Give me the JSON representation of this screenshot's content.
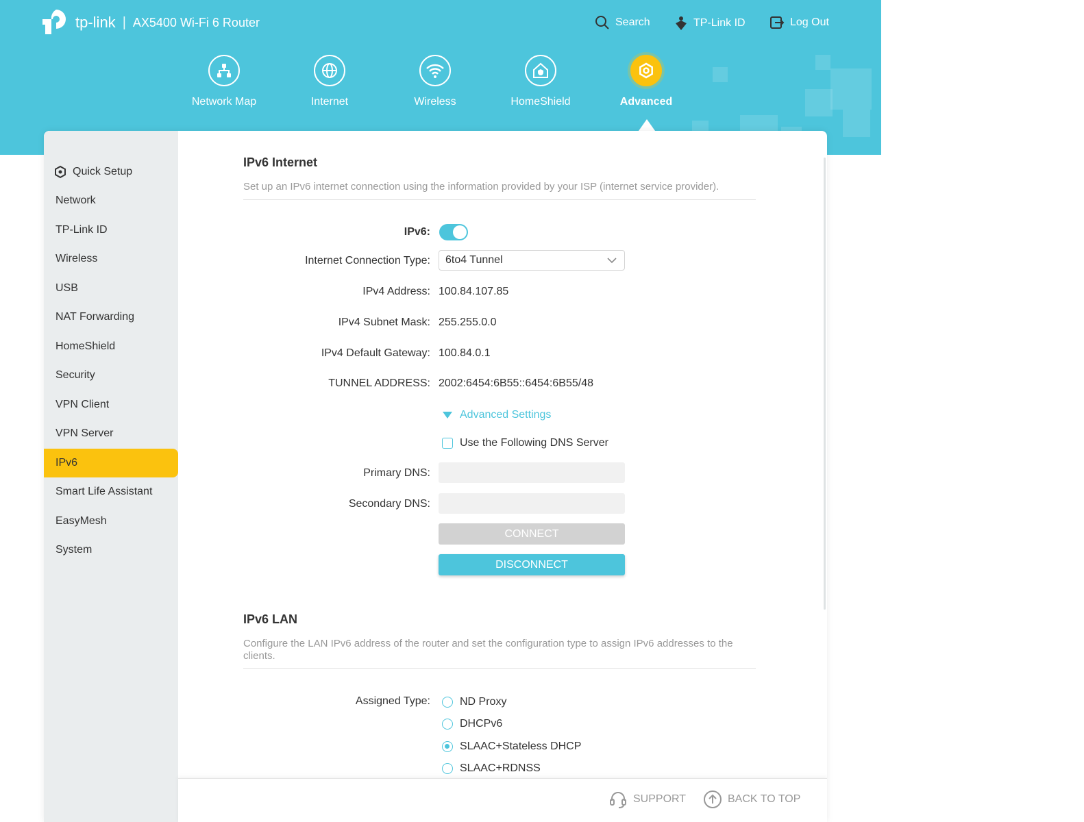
{
  "header": {
    "brand": "tp-link",
    "separator": "|",
    "model": "AX5400 Wi-Fi 6 Router",
    "search_label": "Search",
    "tplink_id_label": "TP-Link ID",
    "logout_label": "Log Out"
  },
  "nav": [
    {
      "label": "Network Map",
      "icon": "network-map-icon"
    },
    {
      "label": "Internet",
      "icon": "globe-icon"
    },
    {
      "label": "Wireless",
      "icon": "wifi-icon"
    },
    {
      "label": "HomeShield",
      "icon": "homeshield-icon"
    },
    {
      "label": "Advanced",
      "icon": "gear-icon",
      "active": true
    }
  ],
  "sidebar": {
    "items": [
      {
        "label": "Quick Setup",
        "icon": "quick-setup-gear-icon"
      },
      {
        "label": "Network"
      },
      {
        "label": "TP-Link ID"
      },
      {
        "label": "Wireless"
      },
      {
        "label": "USB"
      },
      {
        "label": "NAT Forwarding"
      },
      {
        "label": "HomeShield"
      },
      {
        "label": "Security"
      },
      {
        "label": "VPN Client"
      },
      {
        "label": "VPN Server"
      },
      {
        "label": "IPv6",
        "active": true
      },
      {
        "label": "Smart Life Assistant"
      },
      {
        "label": "EasyMesh"
      },
      {
        "label": "System"
      }
    ]
  },
  "ipv6_internet": {
    "title": "IPv6 Internet",
    "description": "Set up an IPv6 internet connection using the information provided by your ISP (internet service provider).",
    "ipv6_label": "IPv6:",
    "ipv6_enabled": true,
    "connection_type_label": "Internet Connection Type:",
    "connection_type_value": "6to4 Tunnel",
    "ipv4_address_label": "IPv4 Address:",
    "ipv4_address_value": "100.84.107.85",
    "subnet_mask_label": "IPv4 Subnet Mask:",
    "subnet_mask_value": "255.255.0.0",
    "gateway_label": "IPv4 Default Gateway:",
    "gateway_value": "100.84.0.1",
    "tunnel_label": "TUNNEL ADDRESS:",
    "tunnel_value": "2002:6454:6B55::6454:6B55/48",
    "advanced_settings_label": "Advanced Settings",
    "dns_checkbox_label": "Use the Following DNS Server",
    "dns_checked": false,
    "primary_dns_label": "Primary DNS:",
    "primary_dns_value": "",
    "secondary_dns_label": "Secondary DNS:",
    "secondary_dns_value": "",
    "connect_label": "CONNECT",
    "disconnect_label": "DISCONNECT"
  },
  "ipv6_lan": {
    "title": "IPv6 LAN",
    "description": "Configure the LAN IPv6 address of the router and set the configuration type to assign IPv6 addresses to the clients.",
    "assigned_type_label": "Assigned Type:",
    "options": [
      {
        "label": "ND Proxy",
        "selected": false
      },
      {
        "label": "DHCPv6",
        "selected": false
      },
      {
        "label": "SLAAC+Stateless DHCP",
        "selected": true
      },
      {
        "label": "SLAAC+RDNSS",
        "selected": false
      }
    ]
  },
  "footer": {
    "support_label": "SUPPORT",
    "back_to_top_label": "BACK TO TOP"
  },
  "colors": {
    "accent": "#4dc5dc",
    "active": "#fbc20e",
    "sidebar_bg": "#eaedee"
  }
}
